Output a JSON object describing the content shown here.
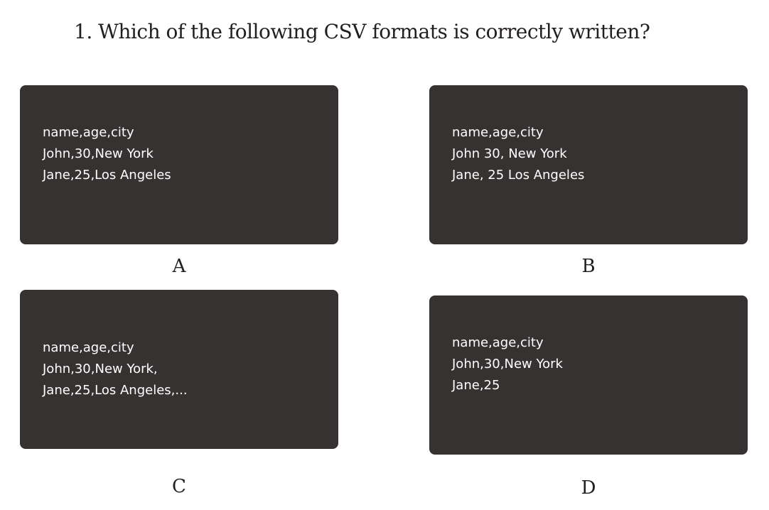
{
  "question": {
    "text": "1. Which of the following CSV formats is correctly written?"
  },
  "options": [
    {
      "label": "A",
      "lines": [
        "name,age,city",
        "John,30,New York",
        "Jane,25,Los Angeles"
      ]
    },
    {
      "label": "B",
      "lines": [
        "name,age,city",
        "John 30, New York",
        "Jane, 25 Los Angeles"
      ]
    },
    {
      "label": "C",
      "lines": [
        "name,age,city",
        "John,30,New York,",
        "Jane,25,Los Angeles,..."
      ]
    },
    {
      "label": "D",
      "lines": [
        "name,age,city",
        "John,30,New York",
        "Jane,25"
      ]
    }
  ],
  "colors": {
    "card_background": "#363232",
    "card_text": "#ffffff",
    "question_text": "#231f1f",
    "page_background": "#ffffff"
  }
}
